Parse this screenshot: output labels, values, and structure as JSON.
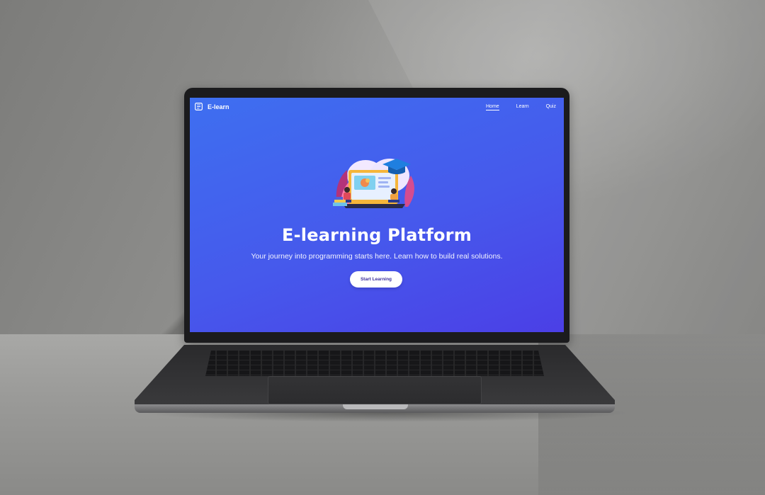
{
  "nav": {
    "brand": "E-learn",
    "links": [
      {
        "label": "Home",
        "active": true
      },
      {
        "label": "Learn",
        "active": false
      },
      {
        "label": "Quiz",
        "active": false
      }
    ]
  },
  "hero": {
    "title": "E-learning Platform",
    "subtitle": "Your journey into programming starts here. Learn how to build real solutions.",
    "cta_label": "Start Learning"
  },
  "icons": {
    "brand": "book-icon",
    "illustration": "online-learning-illustration"
  },
  "colors": {
    "hero_gradient_start": "#3e6ff0",
    "hero_gradient_end": "#4b3fe6",
    "cta_background": "#ffffff",
    "cta_text": "#3c2f9e",
    "text": "#ffffff"
  }
}
